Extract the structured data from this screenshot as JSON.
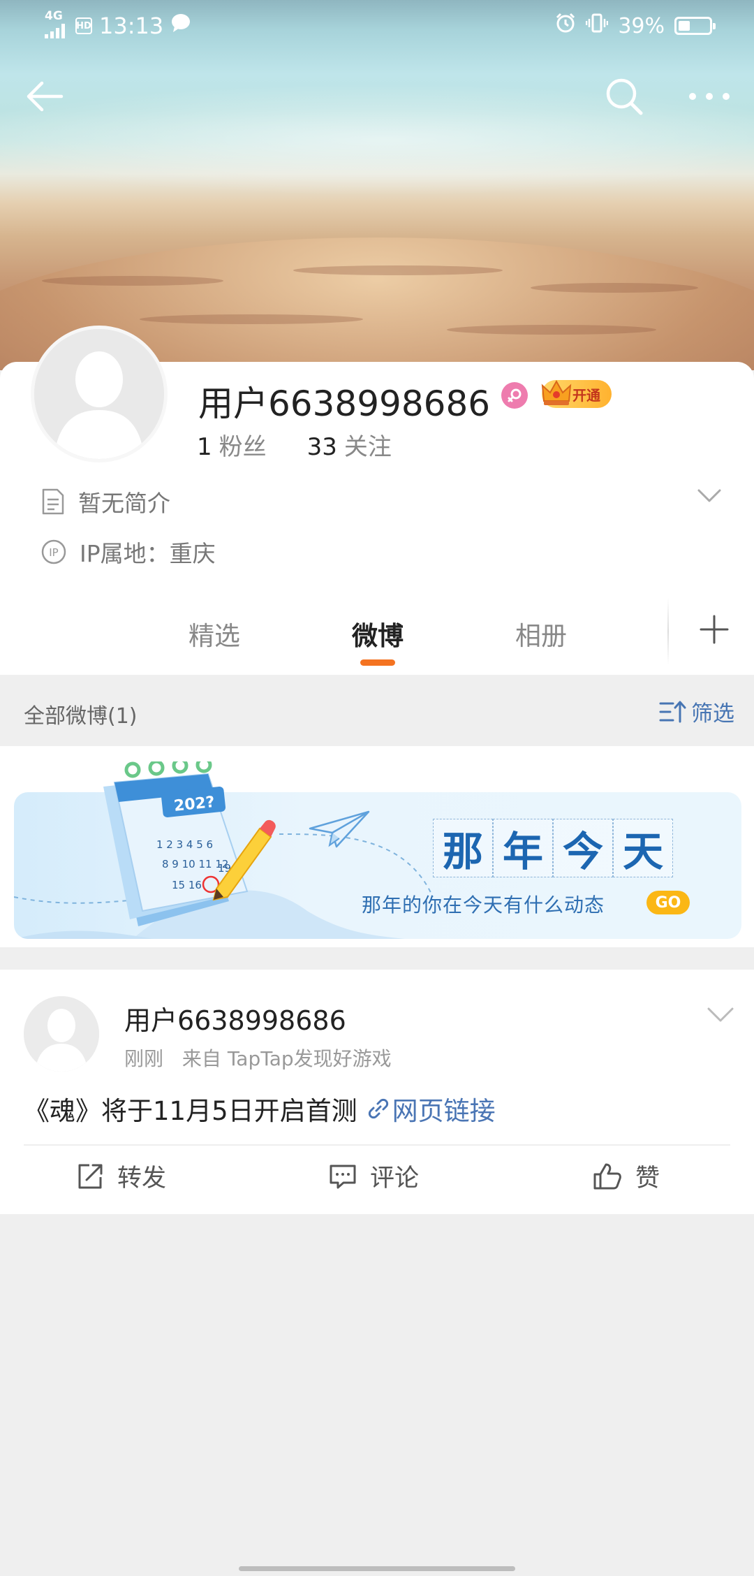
{
  "status_bar": {
    "network": "4G",
    "hd": "HD",
    "time": "13:13",
    "battery_text": "39%",
    "battery_level": 0.39,
    "icons": [
      "signal-icon",
      "hd-icon",
      "message-icon",
      "alarm-icon",
      "vibrate-icon",
      "battery-icon"
    ]
  },
  "nav": {
    "icons": [
      "back-arrow-icon",
      "search-icon",
      "more-icon"
    ]
  },
  "profile": {
    "name": "用户6638998686",
    "vip_label": "开通",
    "fans_count": "1",
    "fans_label": "粉丝",
    "following_count": "33",
    "following_label": "关注",
    "bio": "暂无简介",
    "ip_location": "IP属地：重庆"
  },
  "tabs": [
    {
      "label": "精选",
      "active": false
    },
    {
      "label": "微博",
      "active": true
    },
    {
      "label": "相册",
      "active": false
    }
  ],
  "filter": {
    "count_label": "全部微博(1)",
    "filter_label": "筛选"
  },
  "banner": {
    "year_text": "202?",
    "title_chars": [
      "那",
      "年",
      "今",
      "天"
    ],
    "subtitle": "那年的你在今天有什么动态",
    "go_label": "GO"
  },
  "post": {
    "user": "用户6638998686",
    "time": "刚刚",
    "source": "来自 TapTap发现好游戏",
    "text": "《魂》将于11月5日开启首测",
    "link_label": "网页链接",
    "actions": {
      "repost": "转发",
      "comment": "评论",
      "like": "赞"
    }
  },
  "colors": {
    "accent_orange": "#f47321",
    "link_blue": "#4a75b4",
    "vip_gold": "#ffb22f",
    "gender_pink": "#ee7cae"
  }
}
